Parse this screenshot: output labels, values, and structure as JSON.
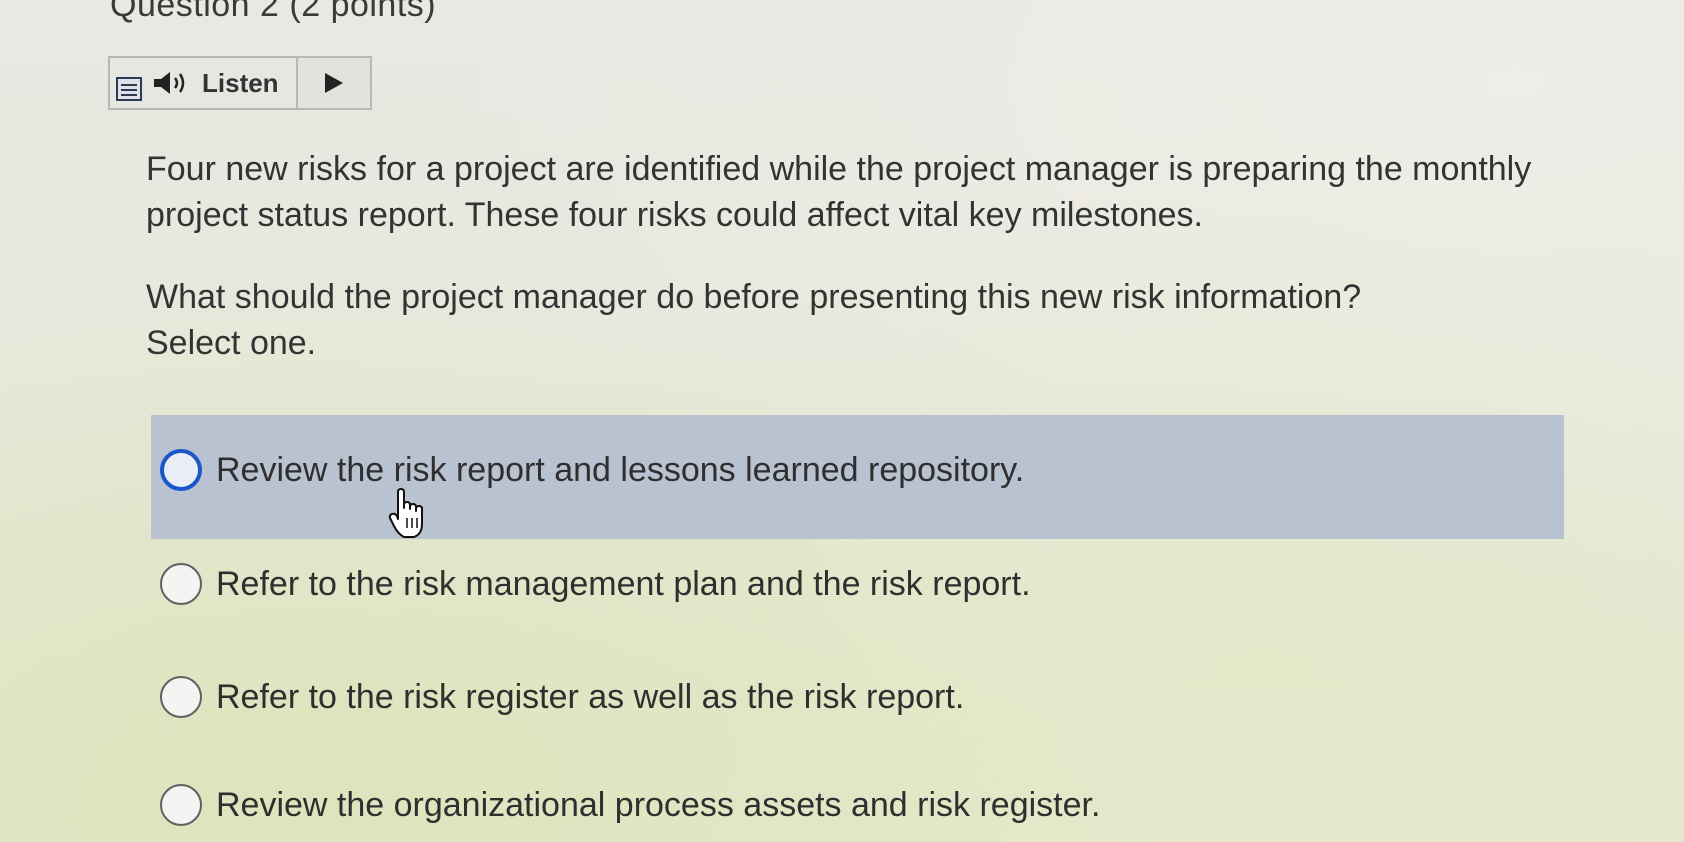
{
  "question": {
    "title": "Question 2 (2 points)",
    "listen_label": "Listen",
    "stem": "Four new risks for a project are identified while the project manager is preparing the monthly project status report. These four risks could affect vital key milestones.",
    "prompt_line1": "What should the project manager do before presenting this new risk information?",
    "prompt_line2": "Select one."
  },
  "options": [
    {
      "label": "Review the risk report and lessons learned repository.",
      "selected": false,
      "hovered": true
    },
    {
      "label": "Refer to the risk management plan and the risk report.",
      "selected": false,
      "hovered": false
    },
    {
      "label": "Refer to the risk register as well as the risk report.",
      "selected": false,
      "hovered": false
    },
    {
      "label": "Review the organizational process assets and risk register.",
      "selected": false,
      "hovered": false
    }
  ],
  "icons": {
    "menu": "menu-icon",
    "speaker": "speaker-icon",
    "play": "play-icon",
    "cursor": "hand-cursor-icon"
  },
  "colors": {
    "highlight": "#b9c2d1",
    "radio_focus": "#1c56c8",
    "text": "#2f2f2f"
  }
}
